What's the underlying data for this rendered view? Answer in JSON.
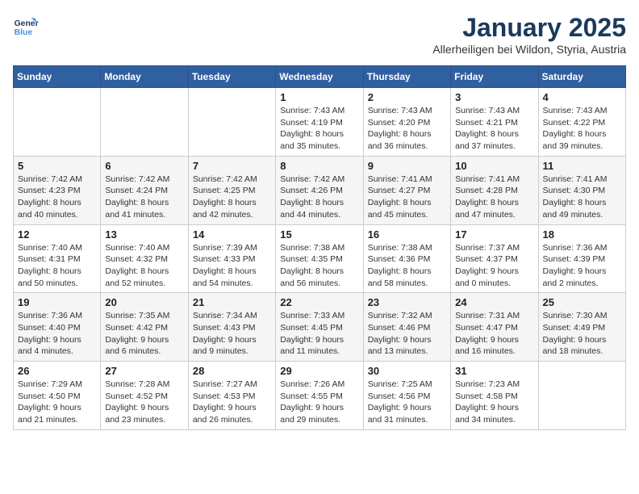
{
  "header": {
    "logo_line1": "General",
    "logo_line2": "Blue",
    "month_title": "January 2025",
    "location": "Allerheiligen bei Wildon, Styria, Austria"
  },
  "weekdays": [
    "Sunday",
    "Monday",
    "Tuesday",
    "Wednesday",
    "Thursday",
    "Friday",
    "Saturday"
  ],
  "weeks": [
    [
      {
        "day": "",
        "info": ""
      },
      {
        "day": "",
        "info": ""
      },
      {
        "day": "",
        "info": ""
      },
      {
        "day": "1",
        "info": "Sunrise: 7:43 AM\nSunset: 4:19 PM\nDaylight: 8 hours and 35 minutes."
      },
      {
        "day": "2",
        "info": "Sunrise: 7:43 AM\nSunset: 4:20 PM\nDaylight: 8 hours and 36 minutes."
      },
      {
        "day": "3",
        "info": "Sunrise: 7:43 AM\nSunset: 4:21 PM\nDaylight: 8 hours and 37 minutes."
      },
      {
        "day": "4",
        "info": "Sunrise: 7:43 AM\nSunset: 4:22 PM\nDaylight: 8 hours and 39 minutes."
      }
    ],
    [
      {
        "day": "5",
        "info": "Sunrise: 7:42 AM\nSunset: 4:23 PM\nDaylight: 8 hours and 40 minutes."
      },
      {
        "day": "6",
        "info": "Sunrise: 7:42 AM\nSunset: 4:24 PM\nDaylight: 8 hours and 41 minutes."
      },
      {
        "day": "7",
        "info": "Sunrise: 7:42 AM\nSunset: 4:25 PM\nDaylight: 8 hours and 42 minutes."
      },
      {
        "day": "8",
        "info": "Sunrise: 7:42 AM\nSunset: 4:26 PM\nDaylight: 8 hours and 44 minutes."
      },
      {
        "day": "9",
        "info": "Sunrise: 7:41 AM\nSunset: 4:27 PM\nDaylight: 8 hours and 45 minutes."
      },
      {
        "day": "10",
        "info": "Sunrise: 7:41 AM\nSunset: 4:28 PM\nDaylight: 8 hours and 47 minutes."
      },
      {
        "day": "11",
        "info": "Sunrise: 7:41 AM\nSunset: 4:30 PM\nDaylight: 8 hours and 49 minutes."
      }
    ],
    [
      {
        "day": "12",
        "info": "Sunrise: 7:40 AM\nSunset: 4:31 PM\nDaylight: 8 hours and 50 minutes."
      },
      {
        "day": "13",
        "info": "Sunrise: 7:40 AM\nSunset: 4:32 PM\nDaylight: 8 hours and 52 minutes."
      },
      {
        "day": "14",
        "info": "Sunrise: 7:39 AM\nSunset: 4:33 PM\nDaylight: 8 hours and 54 minutes."
      },
      {
        "day": "15",
        "info": "Sunrise: 7:38 AM\nSunset: 4:35 PM\nDaylight: 8 hours and 56 minutes."
      },
      {
        "day": "16",
        "info": "Sunrise: 7:38 AM\nSunset: 4:36 PM\nDaylight: 8 hours and 58 minutes."
      },
      {
        "day": "17",
        "info": "Sunrise: 7:37 AM\nSunset: 4:37 PM\nDaylight: 9 hours and 0 minutes."
      },
      {
        "day": "18",
        "info": "Sunrise: 7:36 AM\nSunset: 4:39 PM\nDaylight: 9 hours and 2 minutes."
      }
    ],
    [
      {
        "day": "19",
        "info": "Sunrise: 7:36 AM\nSunset: 4:40 PM\nDaylight: 9 hours and 4 minutes."
      },
      {
        "day": "20",
        "info": "Sunrise: 7:35 AM\nSunset: 4:42 PM\nDaylight: 9 hours and 6 minutes."
      },
      {
        "day": "21",
        "info": "Sunrise: 7:34 AM\nSunset: 4:43 PM\nDaylight: 9 hours and 9 minutes."
      },
      {
        "day": "22",
        "info": "Sunrise: 7:33 AM\nSunset: 4:45 PM\nDaylight: 9 hours and 11 minutes."
      },
      {
        "day": "23",
        "info": "Sunrise: 7:32 AM\nSunset: 4:46 PM\nDaylight: 9 hours and 13 minutes."
      },
      {
        "day": "24",
        "info": "Sunrise: 7:31 AM\nSunset: 4:47 PM\nDaylight: 9 hours and 16 minutes."
      },
      {
        "day": "25",
        "info": "Sunrise: 7:30 AM\nSunset: 4:49 PM\nDaylight: 9 hours and 18 minutes."
      }
    ],
    [
      {
        "day": "26",
        "info": "Sunrise: 7:29 AM\nSunset: 4:50 PM\nDaylight: 9 hours and 21 minutes."
      },
      {
        "day": "27",
        "info": "Sunrise: 7:28 AM\nSunset: 4:52 PM\nDaylight: 9 hours and 23 minutes."
      },
      {
        "day": "28",
        "info": "Sunrise: 7:27 AM\nSunset: 4:53 PM\nDaylight: 9 hours and 26 minutes."
      },
      {
        "day": "29",
        "info": "Sunrise: 7:26 AM\nSunset: 4:55 PM\nDaylight: 9 hours and 29 minutes."
      },
      {
        "day": "30",
        "info": "Sunrise: 7:25 AM\nSunset: 4:56 PM\nDaylight: 9 hours and 31 minutes."
      },
      {
        "day": "31",
        "info": "Sunrise: 7:23 AM\nSunset: 4:58 PM\nDaylight: 9 hours and 34 minutes."
      },
      {
        "day": "",
        "info": ""
      }
    ]
  ]
}
